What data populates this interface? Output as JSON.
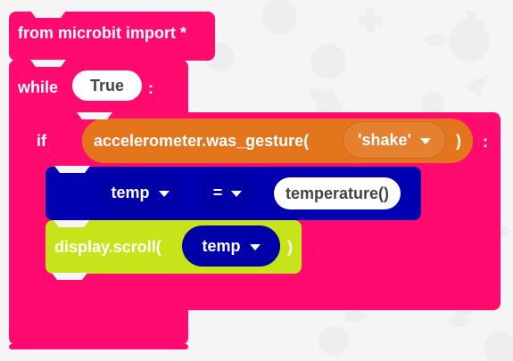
{
  "theme": {
    "pink": "#ff0a6e",
    "orange": "#e3761d",
    "navy": "#0000b0",
    "lime": "#c7e31a",
    "white": "#ffffff",
    "background": "#f5f5f5"
  },
  "blocks": {
    "from_import": {
      "text": "from microbit import *"
    },
    "while": {
      "keyword": "while",
      "condition": "True",
      "colon": ":"
    },
    "if": {
      "keyword": "if",
      "colon": ":"
    },
    "gesture": {
      "call_text": "accelerometer.was_gesture(",
      "gesture_value": "'shake'",
      "close_paren": ")"
    },
    "assign": {
      "variable": "temp",
      "operator": "=",
      "value": "temperature()"
    },
    "display": {
      "call_text": "display.scroll(",
      "argument": "temp",
      "close_paren": ")"
    }
  },
  "icons": {
    "dropdown": "triangle-down-icon",
    "background": "python-logo-pattern"
  }
}
